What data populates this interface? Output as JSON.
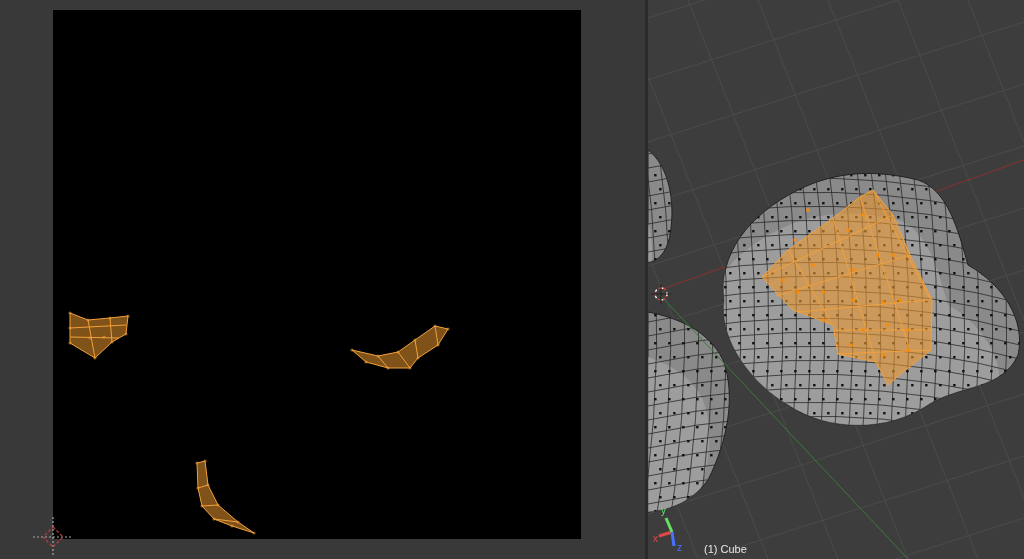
{
  "viewport": {
    "object_label": "(1) Cube",
    "axes": [
      {
        "label": "x",
        "color": "#e04848"
      },
      {
        "label": "y",
        "color": "#66e066"
      },
      {
        "label": "z",
        "color": "#4a70ff"
      }
    ]
  }
}
